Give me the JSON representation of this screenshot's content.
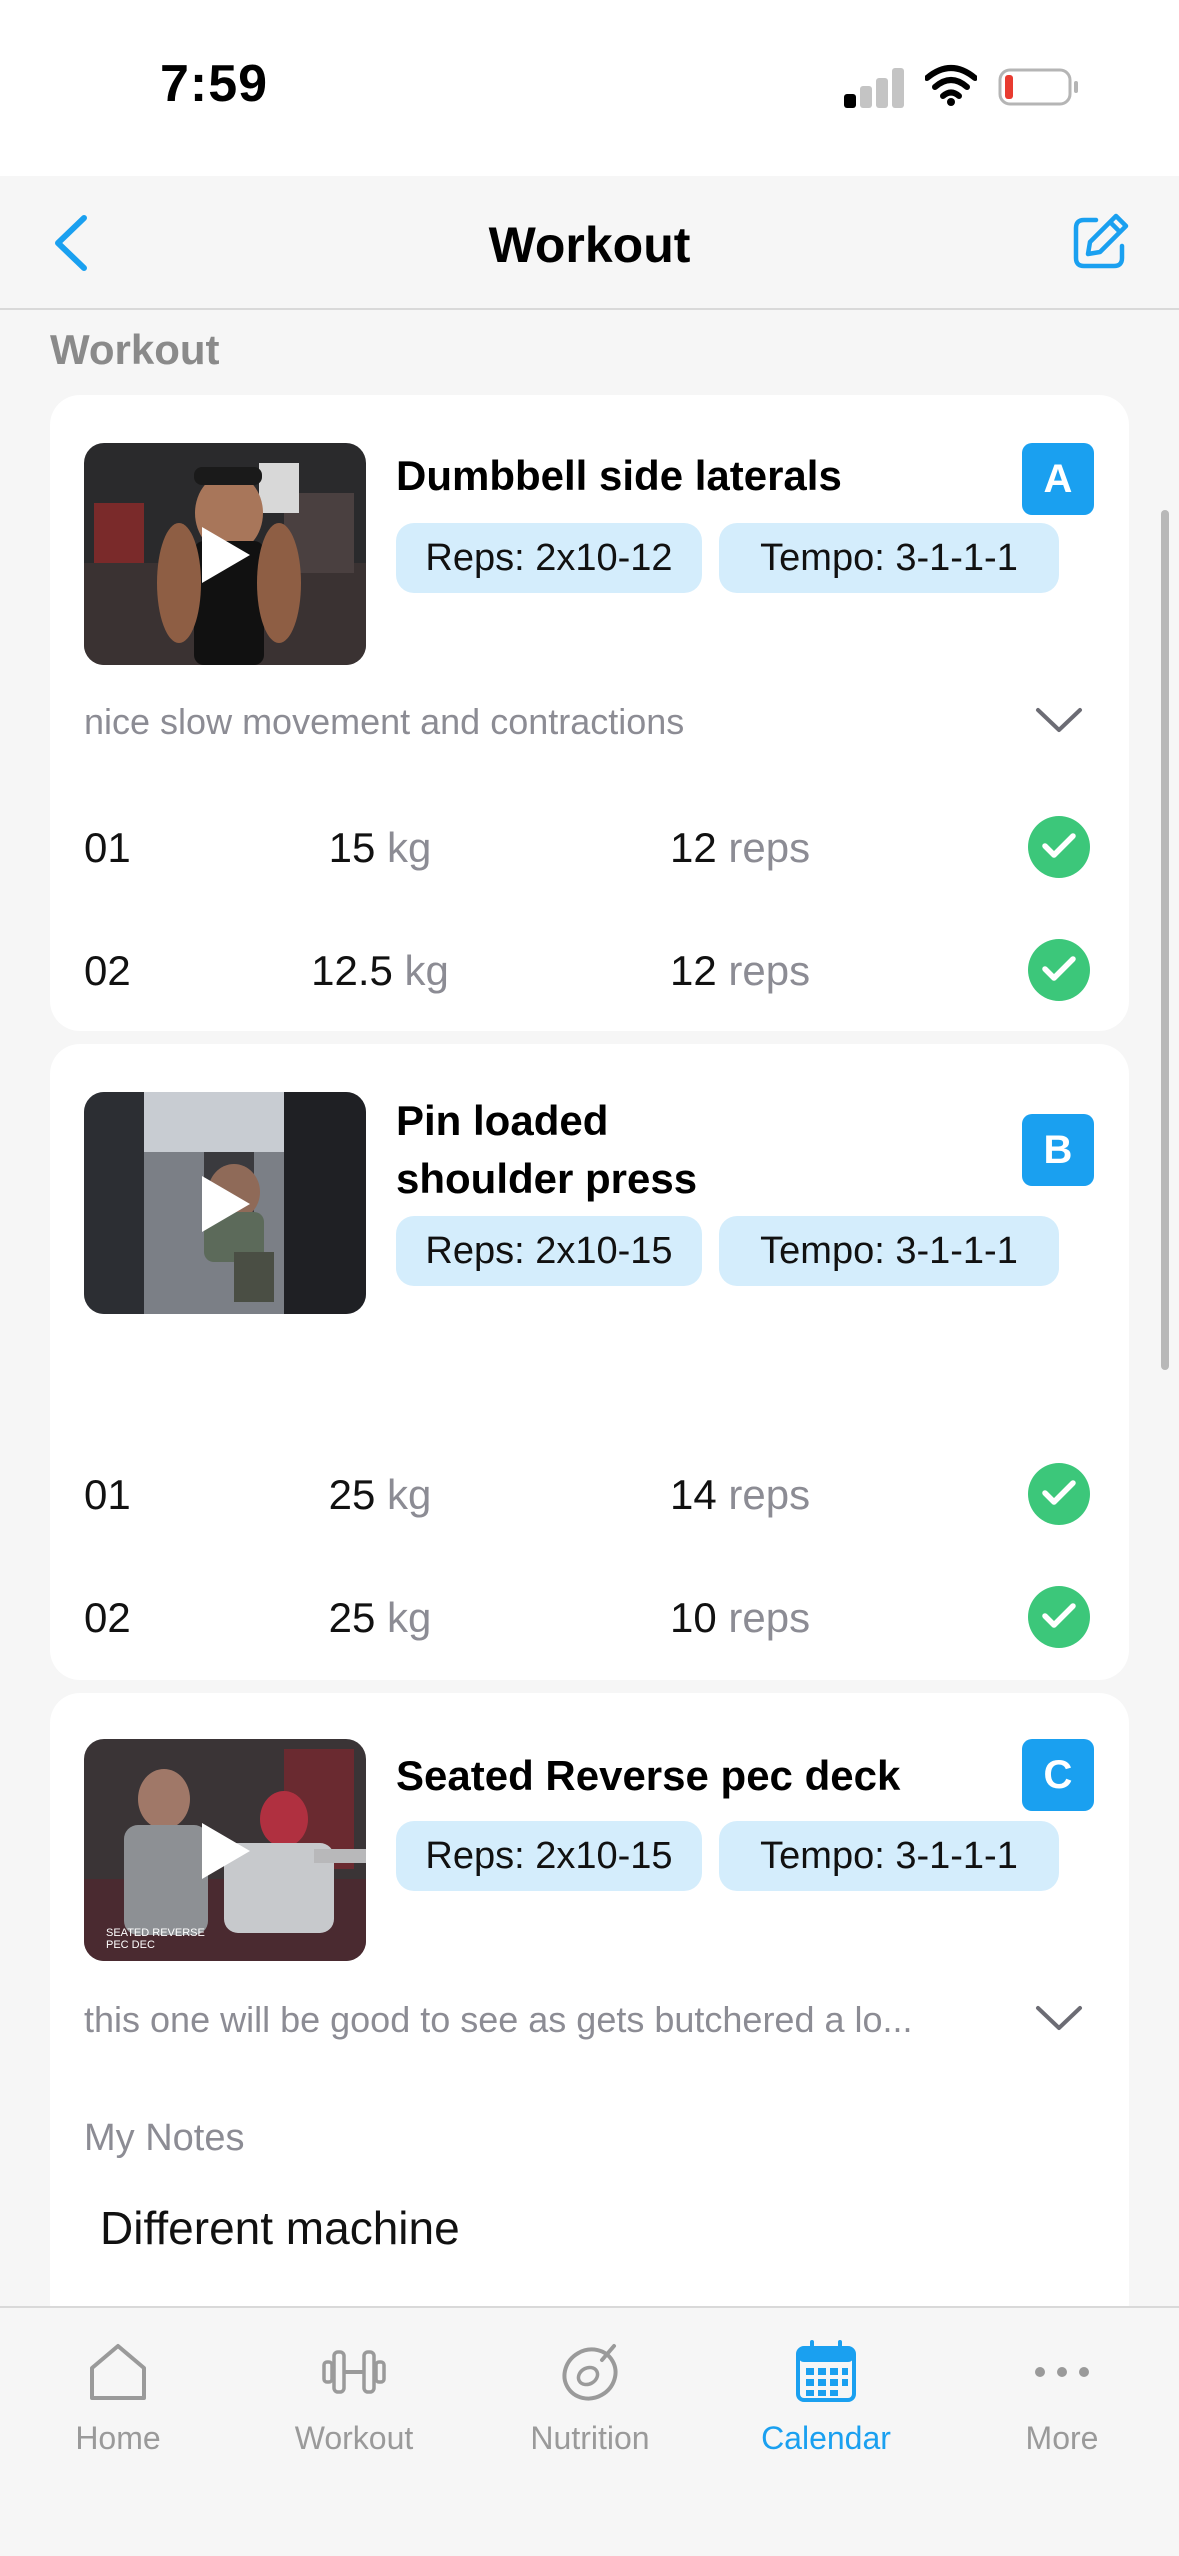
{
  "status_bar": {
    "time": "7:59"
  },
  "nav": {
    "title": "Workout"
  },
  "section_label": "Workout",
  "exercises": [
    {
      "title_line1": "Dumbbell side laterals",
      "title_line2": "",
      "badge": "A",
      "reps_pill": "Reps: 2x10-12",
      "tempo_pill": "Tempo: 3-1-1-1",
      "note": "nice slow movement and contractions",
      "sets": [
        {
          "num": "01",
          "weight": "15",
          "weight_unit": "kg",
          "reps": "12",
          "reps_unit": "reps"
        },
        {
          "num": "02",
          "weight": "12.5",
          "weight_unit": "kg",
          "reps": "12",
          "reps_unit": "reps"
        }
      ]
    },
    {
      "title_line1": "Pin loaded",
      "title_line2": "shoulder press",
      "badge": "B",
      "reps_pill": "Reps: 2x10-15",
      "tempo_pill": "Tempo: 3-1-1-1",
      "note": "",
      "sets": [
        {
          "num": "01",
          "weight": "25",
          "weight_unit": "kg",
          "reps": "14",
          "reps_unit": "reps"
        },
        {
          "num": "02",
          "weight": "25",
          "weight_unit": "kg",
          "reps": "10",
          "reps_unit": "reps"
        }
      ]
    },
    {
      "title_line1": "Seated Reverse pec deck",
      "title_line2": "",
      "badge": "C",
      "reps_pill": "Reps: 2x10-15",
      "tempo_pill": "Tempo: 3-1-1-1",
      "note": "this one will be good to see as gets butchered a lo...",
      "thumb_caption_1": "SEATED REVERSE",
      "thumb_caption_2": "PEC DEC",
      "my_notes_label": "My Notes",
      "my_notes_value": "Different machine"
    }
  ],
  "tabs": [
    {
      "label": "Home",
      "icon": "home-icon",
      "active": false
    },
    {
      "label": "Workout",
      "icon": "dumbbell-icon",
      "active": false
    },
    {
      "label": "Nutrition",
      "icon": "nutrition-icon",
      "active": false
    },
    {
      "label": "Calendar",
      "icon": "calendar-icon",
      "active": true
    },
    {
      "label": "More",
      "icon": "more-icon",
      "active": false
    }
  ],
  "colors": {
    "accent": "#1aa0f0",
    "pill_bg": "#d4edfc",
    "check_green": "#3cc77a",
    "muted_text": "#8c8c94"
  }
}
